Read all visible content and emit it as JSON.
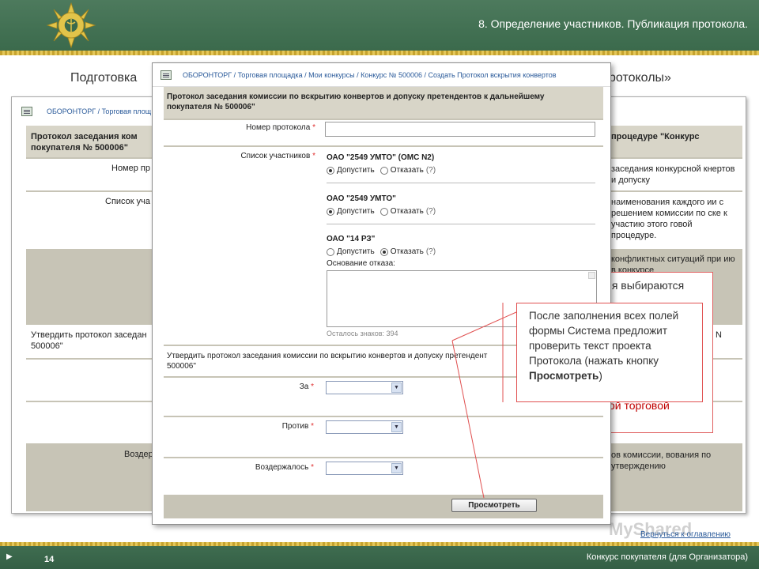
{
  "slide": {
    "title": "8. Определение участников. Публикация протокола.",
    "heading_left": "Подготовка",
    "heading_right": "ротоколы»",
    "page_number": "14",
    "footer": "Конкурс покупателя (для Организатора)"
  },
  "back_window": {
    "breadcrumb": "ОБОРОНТОРГ / Торговая площ",
    "header_left": "Протокол заседания ком покупателя № 500006\"",
    "header_right": "процедуре \"Конкурс",
    "rows": [
      {
        "label": "Номер пр",
        "right": "заседания конкурсной кнертов и допуску"
      },
      {
        "label": "Список уча",
        "right": "наименования каждого ии с решением комиссии по ске к участию этого говой процедуре."
      },
      {
        "label": "",
        "right": "конфликтных ситуаций при ию в конкурсе"
      },
      {
        "label": "Утвердить протокол заседан 500006\"",
        "right": "N"
      },
      {
        "label": "Воздер",
        "right": "ов комиссии, вования по утверждению"
      }
    ],
    "red_text_top": "ия выбираются",
    "red_text_bottom": "ой торговой",
    "back_link": "Вернуться к оглавлению"
  },
  "form": {
    "breadcrumb": "ОБОРОНТОРГ / Торговая площадка / Мои конкурсы / Конкурс № 500006 / Создать Протокол вскрытия конвертов",
    "header": "Протокол заседания комиссии по вскрытию конвертов и допуску претендентов к дальнейшему",
    "header2": "покупателя № 500006\"",
    "protocol_number_label": "Номер протокола",
    "protocol_number_value": "",
    "participants_label": "Список участников",
    "required_mark": "*",
    "participants": [
      {
        "name": "ОАО \"2549 УМТО\" (ОМС N2)",
        "admit": "Допустить",
        "reject": "Отказать",
        "help": "(?)",
        "selected": "admit"
      },
      {
        "name": "ОАО \"2549 УМТО\"",
        "admit": "Допустить",
        "reject": "Отказать",
        "help": "(?)",
        "selected": "admit"
      },
      {
        "name": "ОАО \"14 РЗ\"",
        "admit": "Допустить",
        "reject": "Отказать",
        "help": "(?)",
        "selected": "reject"
      }
    ],
    "reason_label": "Основание отказа:",
    "chars_left": "Осталось знаков: 394",
    "approve_text": "Утвердить протокол заседания комиссии по вскрытию конвертов и допуску претендент",
    "approve_text2": "500006\"",
    "votes_for": "За",
    "votes_against": "Против",
    "votes_abstained": "Воздержалось",
    "preview_button": "Просмотреть"
  },
  "callout": {
    "text": "После заполнения всех полей формы Система предложит проверить текст проекта Протокола (нажать кнопку ",
    "bold": "Просмотреть",
    "tail": ")"
  },
  "watermark": "MyShared",
  "colors": {
    "band": "#3b6a4c",
    "stripe": "#c6a32e",
    "link": "#2a5a9a",
    "callout_border": "#e05050",
    "table_bg": "#c7c4b6"
  }
}
